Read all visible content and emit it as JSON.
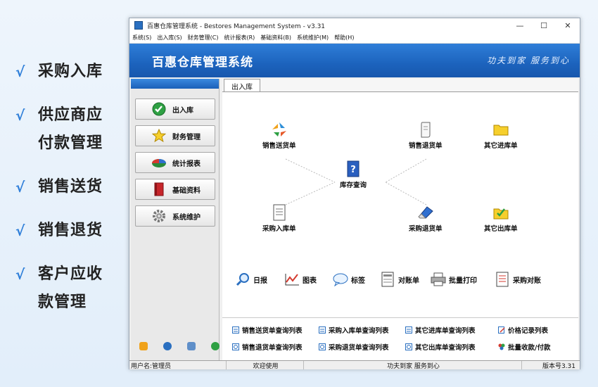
{
  "features": [
    {
      "line1": "采购入库",
      "line2": ""
    },
    {
      "line1": "供应商应",
      "line2": "付款管理"
    },
    {
      "line1": "销售送货",
      "line2": ""
    },
    {
      "line1": "销售退货",
      "line2": ""
    },
    {
      "line1": "客户应收",
      "line2": "款管理"
    }
  ],
  "check_mark": "√",
  "window": {
    "title": "百惠仓库管理系统 - Bestores Management System - v3.31",
    "controls": {
      "minimize": "—",
      "maximize": "☐",
      "close": "✕"
    }
  },
  "menu": [
    "系统(S)",
    "出入库(S)",
    "财务管理(C)",
    "统计报表(R)",
    "基础资料(B)",
    "系统维护(M)",
    "帮助(H)"
  ],
  "banner": {
    "brand": "百惠仓库管理系统",
    "slogan": "功夫到家 服务到心"
  },
  "sidebar": {
    "items": [
      {
        "label": "出入库",
        "icon": "check-circle-icon"
      },
      {
        "label": "财务管理",
        "icon": "star-icon"
      },
      {
        "label": "统计报表",
        "icon": "pie-chart-icon"
      },
      {
        "label": "基础资料",
        "icon": "book-icon"
      },
      {
        "label": "系统维护",
        "icon": "gear-icon"
      }
    ]
  },
  "tab": "出入库",
  "diagram": {
    "sales_delivery": "销售送货单",
    "sales_return": "销售退货单",
    "other_in": "其它进库单",
    "inventory": "库存查询",
    "purchase_in": "采购入库单",
    "purchase_return": "采购退货单",
    "other_out": "其它出库单"
  },
  "tools": [
    "日报",
    "图表",
    "标签",
    "对账单",
    "批量打印",
    "采购对账"
  ],
  "links": [
    [
      "销售送货单查询列表",
      "采购入库单查询列表",
      "其它进库单查询列表",
      "价格记录列表"
    ],
    [
      "销售退货单查询列表",
      "采购退货单查询列表",
      "其它出库单查询列表",
      "批量收款/付款"
    ]
  ],
  "status": {
    "user": "用户名:管理员",
    "welcome": "欢迎使用",
    "slogan": "功夫到家 服务到心",
    "version": "版本号3.31"
  },
  "colors": {
    "accent": "#1c63bd",
    "check": "#2f7fd9"
  }
}
